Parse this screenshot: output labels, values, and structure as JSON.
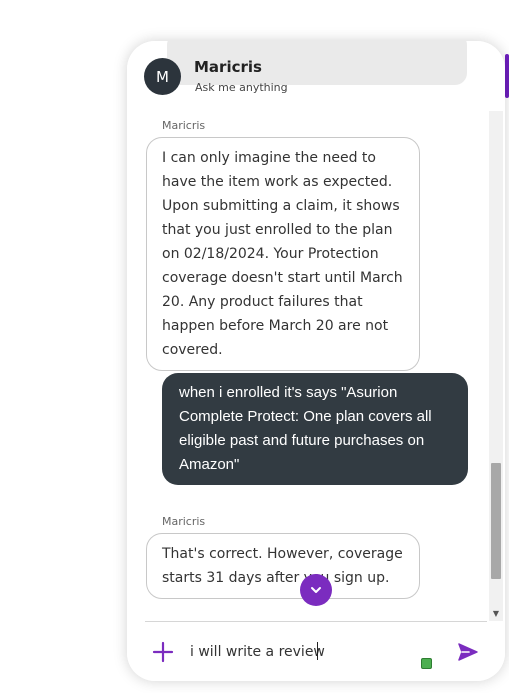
{
  "header": {
    "avatar_initial": "M",
    "agent_name": "Maricris",
    "subtitle": "Ask me anything"
  },
  "messages": [
    {
      "role": "agent",
      "sender": "Maricris",
      "text": "I can only imagine the need to have the item work as expected. Upon submitting a claim, it shows that you just enrolled to the plan on 02/18/2024. Your Protection coverage doesn't start until March 20. Any product failures that happen before March 20 are not covered."
    },
    {
      "role": "user",
      "text": "when i enrolled it's says \"Asurion Complete Protect: One plan covers all eligible past and future purchases on Amazon\""
    },
    {
      "role": "agent",
      "sender": "Maricris",
      "text": "That's correct. However, coverage starts 31 days after you sign up."
    }
  ],
  "composer": {
    "value": "i will write a review"
  },
  "icons": {
    "add": "plus-icon",
    "send": "send-icon",
    "jump": "chevron-down-icon"
  },
  "colors": {
    "accent": "#7b2cbf",
    "user_bubble": "#323b42",
    "avatar": "#2c343c",
    "status": "#4caf50"
  }
}
